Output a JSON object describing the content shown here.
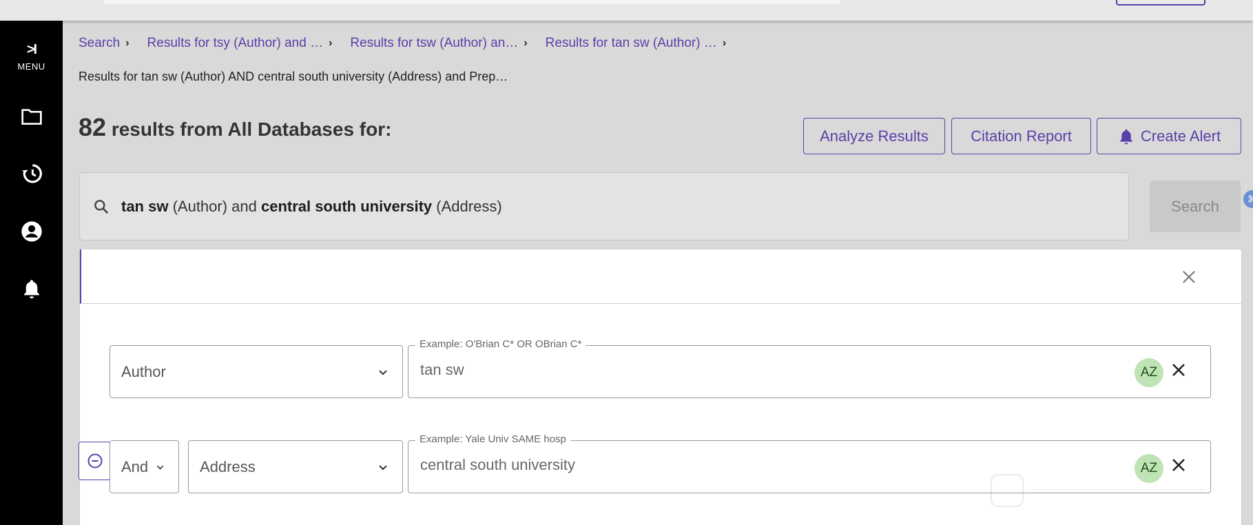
{
  "sidebar": {
    "menu_glyph": ">I",
    "menu_label": "MENU",
    "icons": [
      "folder-icon",
      "history-icon",
      "account-icon",
      "bell-icon"
    ]
  },
  "breadcrumbs": {
    "items": [
      "Search",
      "Results for tsy (Author) and …",
      "Results for tsw (Author) an…",
      "Results for tan sw (Author) …"
    ],
    "current": "Results for tan sw (Author) AND central south university (Address) and Prep…"
  },
  "results": {
    "count": "82",
    "text": " results from All Databases for:"
  },
  "actions": {
    "analyze": "Analyze Results",
    "citation": "Citation Report",
    "alert": "Create Alert"
  },
  "search": {
    "term1": "tan sw",
    "field1": " (Author) and ",
    "term2": "central south university",
    "field2": " (Address)",
    "button": "Search"
  },
  "rows": [
    {
      "field": "Author",
      "example": "Example: O'Brian C* OR OBrian C*",
      "value": "tan sw",
      "az": "AZ"
    },
    {
      "operator": "And",
      "field": "Address",
      "example": "Example: Yale Univ SAME hosp",
      "value": "central south university",
      "az": "AZ"
    }
  ],
  "colors": {
    "accent": "#5b3fa8",
    "sidebar": "#000000",
    "az_bg": "#bfe3b4"
  }
}
